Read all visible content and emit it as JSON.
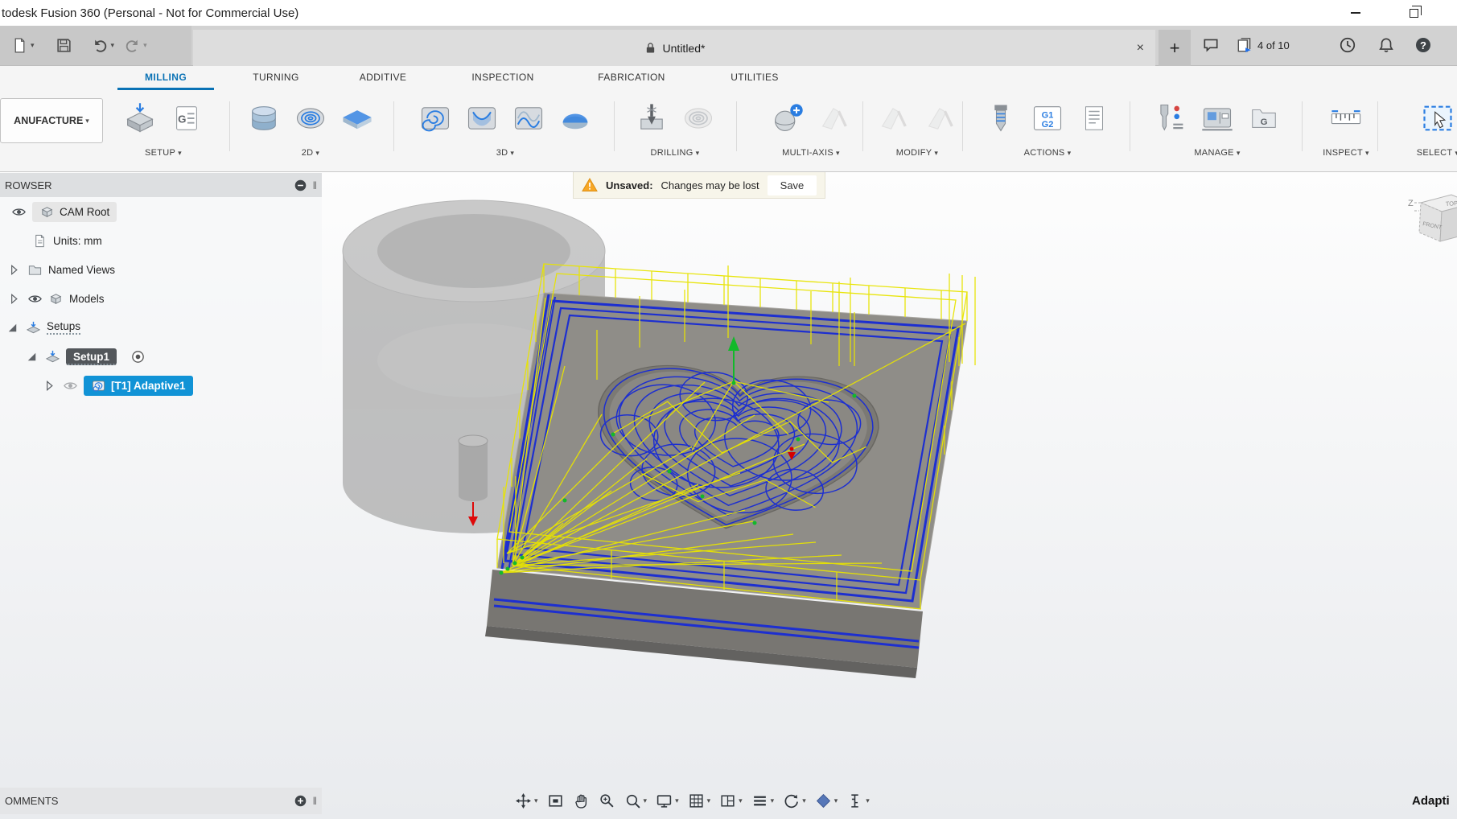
{
  "window": {
    "title": "todesk Fusion 360 (Personal - Not for Commercial Use)"
  },
  "appbar": {
    "doc_title": "Untitled*",
    "job_counter": "4 of 10",
    "new_tab": "+",
    "close_tab": "×"
  },
  "ribbon": {
    "workspace": "ANUFACTURE",
    "tabs": {
      "milling": "MILLING",
      "turning": "TURNING",
      "additive": "ADDITIVE",
      "inspection": "INSPECTION",
      "fabrication": "FABRICATION",
      "utilities": "UTILITIES"
    },
    "groups": {
      "setup": "SETUP",
      "d2": "2D",
      "d3": "3D",
      "drilling": "DRILLING",
      "multiaxis": "MULTI-AXIS",
      "modify": "MODIFY",
      "actions": "ACTIONS",
      "manage": "MANAGE",
      "inspect": "INSPECT",
      "select": "SELECT"
    }
  },
  "browser": {
    "header": "ROWSER",
    "cam_root": "CAM Root",
    "units": "Units: mm",
    "named_views": "Named Views",
    "models": "Models",
    "setups": "Setups",
    "setup1": "Setup1",
    "adaptive1": "[T1] Adaptive1"
  },
  "warning": {
    "label": "Unsaved:",
    "message": "Changes may be lost",
    "save": "Save"
  },
  "viewcube": {
    "z": "Z",
    "top": "TOP",
    "front": "FRONT"
  },
  "panels": {
    "comments": "OMMENTS"
  },
  "status": {
    "operation": "Adapti"
  },
  "glyphs": {
    "caret": "▾",
    "grip": "‖",
    "help": "?",
    "g": "G",
    "g1": "G1",
    "g2": "G2"
  },
  "colors": {
    "accent_blue": "#0a72b5",
    "selection_blue": "#1193d6",
    "selection_dark": "#53575b",
    "toolpath_cut": "#1d2fd0",
    "toolpath_rapid": "#e8e400",
    "warning": "#f7a725"
  }
}
